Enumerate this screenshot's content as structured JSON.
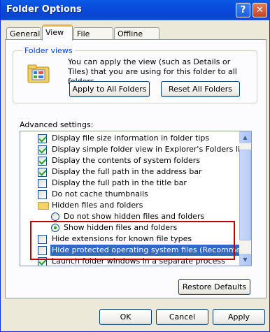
{
  "window": {
    "title": "Folder Options",
    "help_glyph": "?",
    "close_glyph": "✕"
  },
  "tabs": [
    {
      "label": "General",
      "active": false
    },
    {
      "label": "View",
      "active": true
    },
    {
      "label": "File Types",
      "active": false
    },
    {
      "label": "Offline Files",
      "active": false
    }
  ],
  "folder_views": {
    "legend": "Folder views",
    "description": "You can apply the view (such as Details or Tiles) that you are using for this folder to all folders.",
    "apply_all_label": "Apply to All Folders",
    "reset_all_label": "Reset All Folders"
  },
  "advanced": {
    "label": "Advanced settings:",
    "items": [
      {
        "type": "checkbox",
        "checked": true,
        "label": "Display file size information in folder tips"
      },
      {
        "type": "checkbox",
        "checked": true,
        "label": "Display simple folder view in Explorer's Folders list"
      },
      {
        "type": "checkbox",
        "checked": true,
        "label": "Display the contents of system folders"
      },
      {
        "type": "checkbox",
        "checked": true,
        "label": "Display the full path in the address bar"
      },
      {
        "type": "checkbox",
        "checked": false,
        "label": "Display the full path in the title bar"
      },
      {
        "type": "checkbox",
        "checked": false,
        "label": "Do not cache thumbnails"
      },
      {
        "type": "folder",
        "label": "Hidden files and folders"
      },
      {
        "type": "radio",
        "checked": false,
        "label": "Do not show hidden files and folders"
      },
      {
        "type": "radio",
        "checked": true,
        "label": "Show hidden files and folders"
      },
      {
        "type": "checkbox",
        "checked": false,
        "label": "Hide extensions for known file types"
      },
      {
        "type": "checkbox",
        "checked": false,
        "label": "Hide protected operating system files (Recommended)",
        "highlighted": true
      },
      {
        "type": "checkbox",
        "checked": true,
        "label": "Launch folder windows in a separate process"
      }
    ]
  },
  "buttons": {
    "restore_defaults": "Restore Defaults",
    "ok": "OK",
    "cancel": "Cancel",
    "apply": "Apply"
  },
  "colors": {
    "titlebar": "#0a4bdb",
    "highlight": "#316ac5",
    "annotation_box": "#c00000",
    "check": "#21a121"
  }
}
